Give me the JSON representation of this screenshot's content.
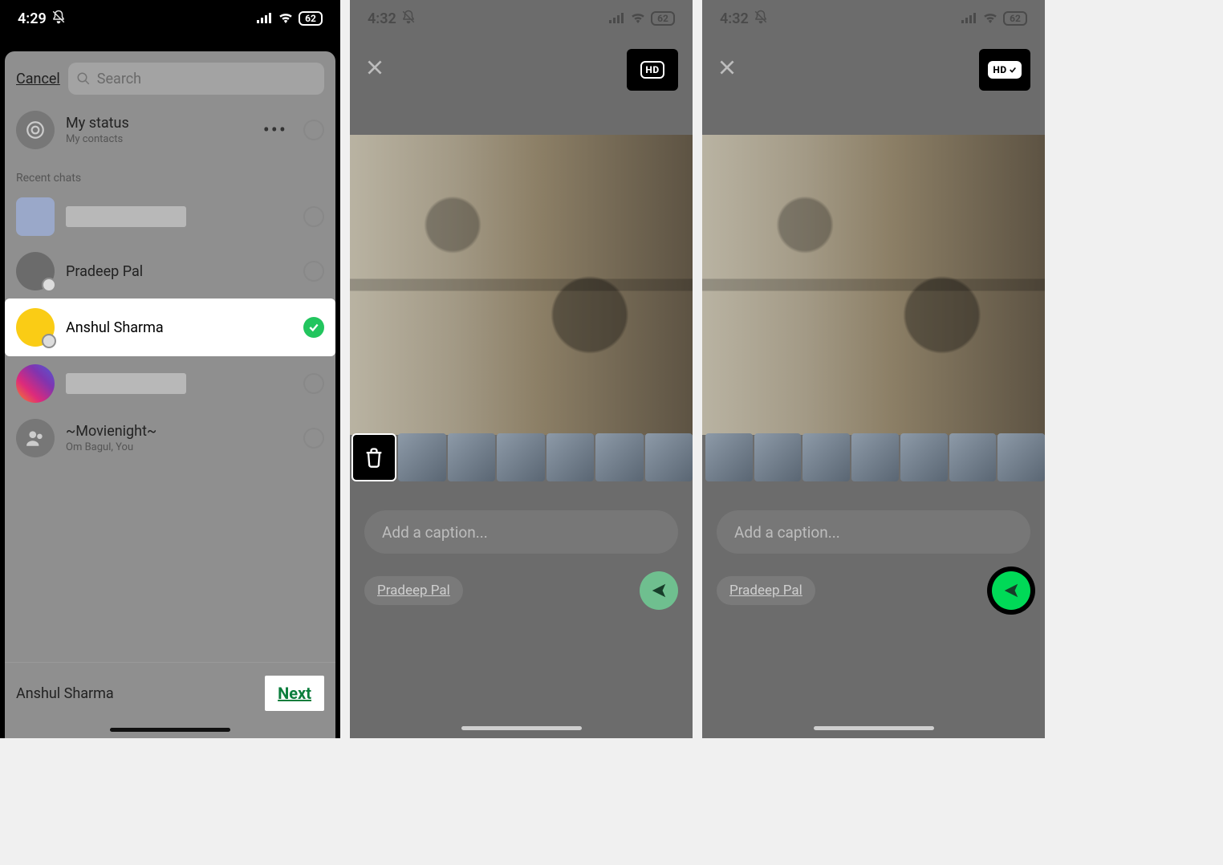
{
  "phone1": {
    "status": {
      "time": "4:29",
      "battery": "62"
    },
    "cancel": "Cancel",
    "search_placeholder": "Search",
    "my_status": {
      "title": "My status",
      "sub": "My contacts"
    },
    "recent_label": "Recent chats",
    "rows": {
      "pradeep": "Pradeep Pal",
      "anshul": "Anshul Sharma",
      "movienight": {
        "title": "~Movienight~",
        "sub": "Om Bagul, You"
      }
    },
    "footer_name": "Anshul Sharma",
    "next": "Next"
  },
  "phone2": {
    "status": {
      "time": "4:32",
      "battery": "62"
    },
    "hd": "HD",
    "caption_placeholder": "Add a caption...",
    "recipient": "Pradeep Pal"
  },
  "phone3": {
    "status": {
      "time": "4:32",
      "battery": "62"
    },
    "hd": "HD",
    "caption_placeholder": "Add a caption...",
    "recipient": "Pradeep Pal"
  }
}
